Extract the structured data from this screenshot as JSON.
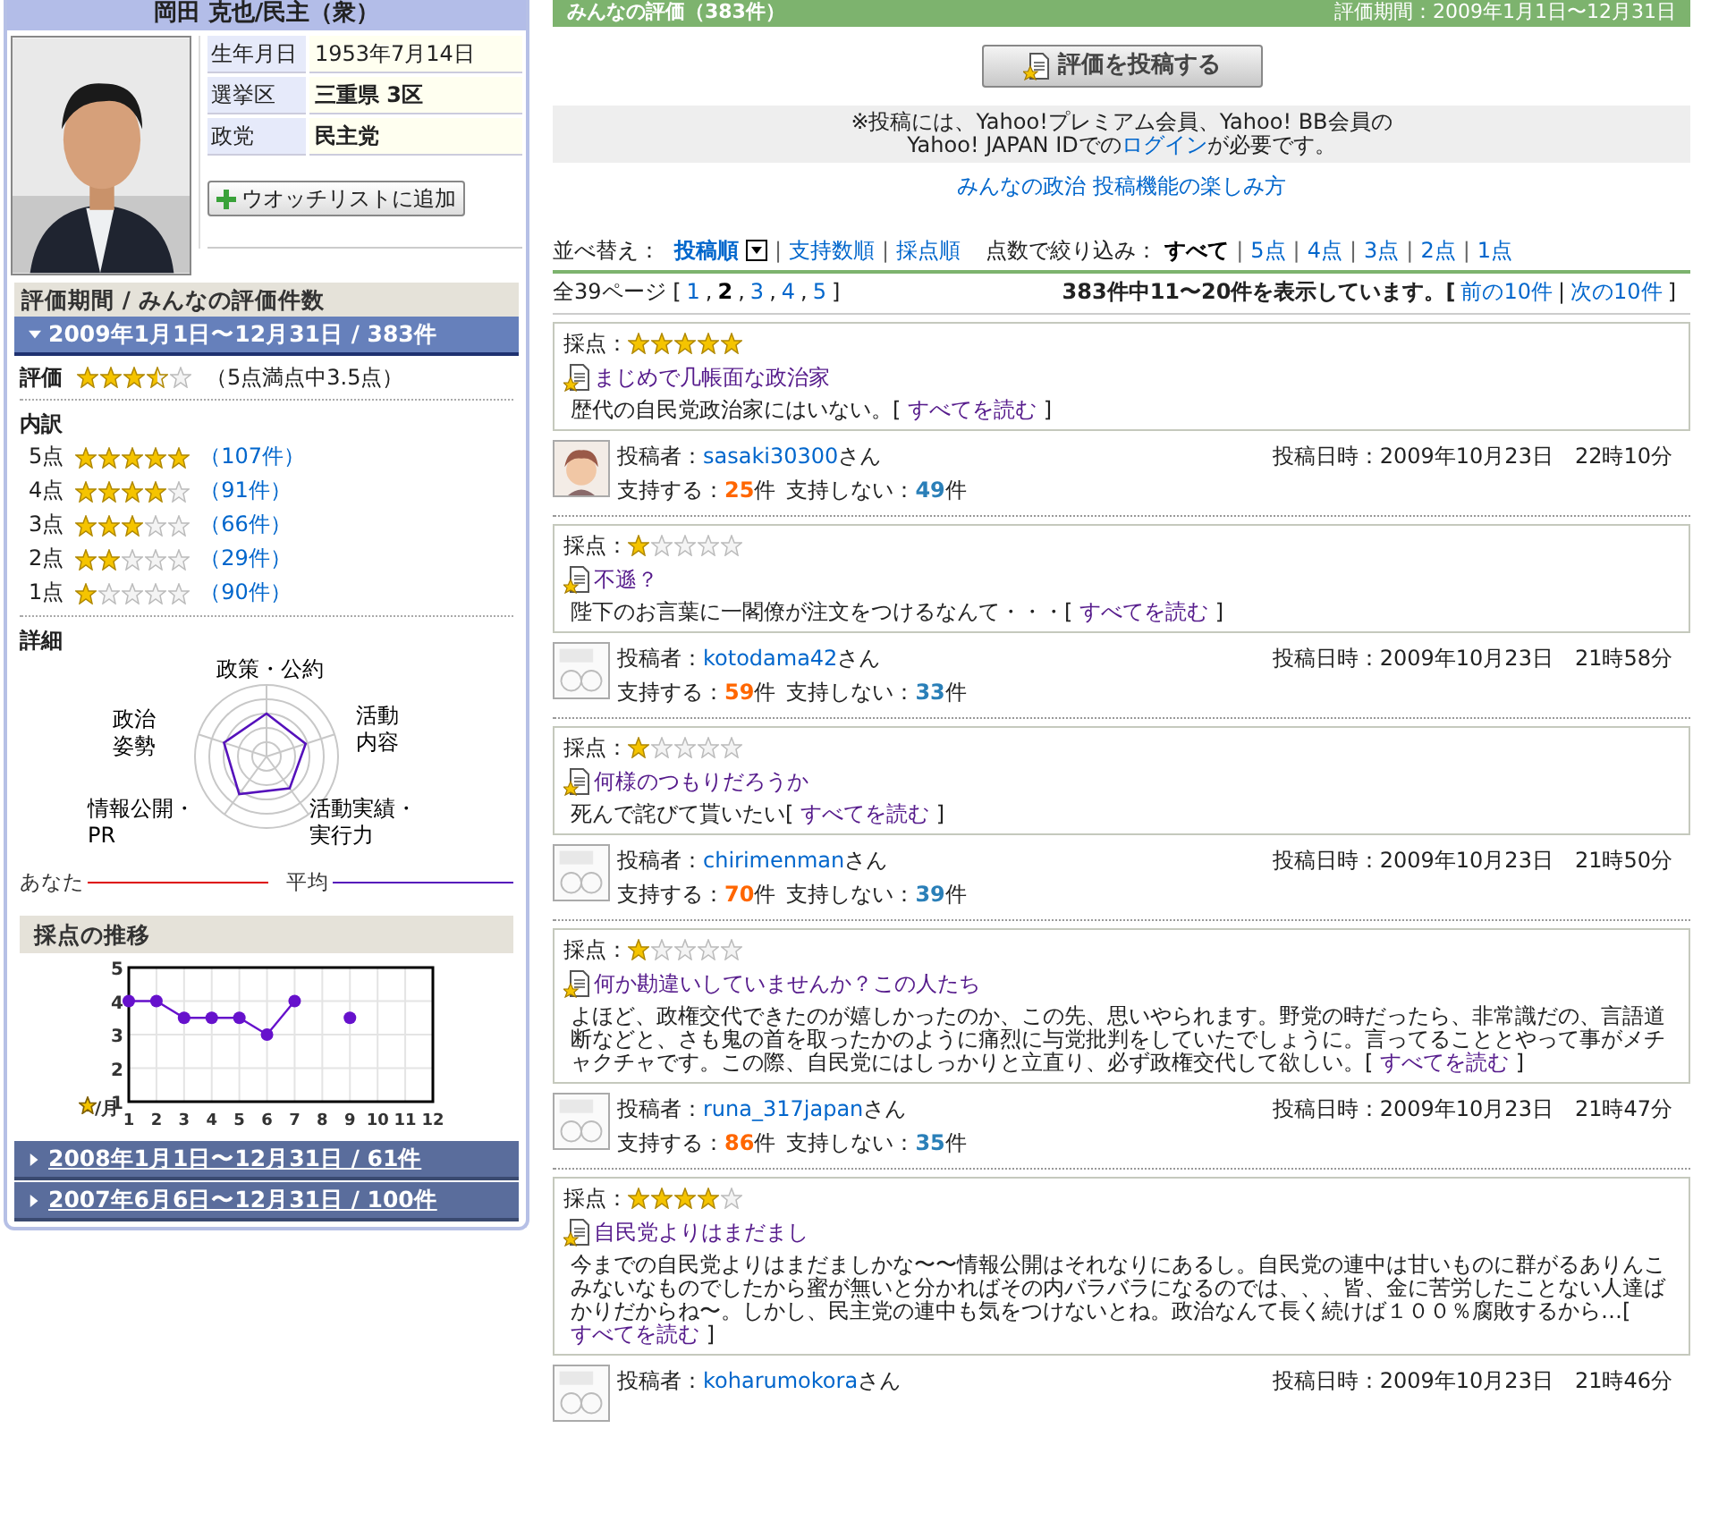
{
  "profile": {
    "name": "岡田 克也/民主（衆）",
    "info": [
      {
        "label": "生年月日",
        "value": "1953年7月14日",
        "bold": false
      },
      {
        "label": "選挙区",
        "value": "三重県 3区",
        "bold": true
      },
      {
        "label": "政党",
        "value": "民主党",
        "bold": true
      }
    ],
    "watch_button": "ウオッチリストに追加"
  },
  "periods_header": "評価期間 / みんなの評価件数",
  "periods": [
    {
      "label": "2009年1月1日〜12月31日 / 383件",
      "expanded": true
    },
    {
      "label": "2008年1月1日〜12月31日 / 61件",
      "expanded": false
    },
    {
      "label": "2007年6月6日〜12月31日 / 100件",
      "expanded": false
    }
  ],
  "current": {
    "rating": {
      "label": "評価",
      "stars": 3.5,
      "text": "（5点満点中3.5点）"
    },
    "breakdown": {
      "title": "内訳",
      "rows": [
        {
          "label": "5点",
          "stars": 5,
          "count": "（107件）"
        },
        {
          "label": "4点",
          "stars": 4,
          "count": "（91件）"
        },
        {
          "label": "3点",
          "stars": 3,
          "count": "（66件）"
        },
        {
          "label": "2点",
          "stars": 2,
          "count": "（29件）"
        },
        {
          "label": "1点",
          "stars": 1,
          "count": "（90件）"
        }
      ]
    },
    "detail": {
      "title": "詳細",
      "axes": [
        "政策・公約",
        "政治姿勢",
        "活動内容",
        "情報公開・PR",
        "活動実績・実行力"
      ],
      "legend": [
        {
          "label": "あなた",
          "color": "#dd0000"
        },
        {
          "label": "平均",
          "color": "#5511bb"
        }
      ]
    },
    "trend": {
      "title": "採点の推移",
      "corner_label": "/月",
      "chart_data": {
        "type": "line",
        "grid": true,
        "categories": [
          "1",
          "2",
          "3",
          "4",
          "5",
          "6",
          "7",
          "8",
          "9",
          "10",
          "11",
          "12"
        ],
        "yticks": [
          1,
          2,
          3,
          4,
          5
        ],
        "ylim": [
          1,
          5
        ],
        "series": [
          {
            "marker": true,
            "color": "#6611cc",
            "values": [
              4,
              4,
              3.5,
              3.5,
              3.5,
              3,
              4,
              null,
              3.5,
              null,
              null,
              null
            ]
          }
        ]
      }
    }
  },
  "reviews_header": {
    "title": "みんなの評価（383件）",
    "period": "評価期間：2009年1月1日〜12月31日"
  },
  "post_button": "評価を投稿する",
  "notice": {
    "line1": "※投稿には、Yahoo!プレミアム会員、Yahoo! BB会員の",
    "line2_before": "Yahoo! JAPAN IDでの",
    "login_link": "ログイン",
    "line2_after": "が必要です。"
  },
  "help_link": "みんなの政治 投稿機能の楽しみ方",
  "sort": {
    "label": "並べ替え：",
    "options": [
      {
        "label": "投稿順",
        "selected": true
      },
      {
        "sep": "|",
        "label": "支持数順",
        "selected": false
      },
      {
        "sep": "|",
        "label": "採点順",
        "selected": false
      }
    ]
  },
  "filter": {
    "label": "点数で絞り込み：",
    "options": [
      {
        "label": "すべて",
        "selected": true
      },
      {
        "sep": "|",
        "label": "5点",
        "selected": false
      },
      {
        "sep": "|",
        "label": "4点",
        "selected": false
      },
      {
        "sep": "|",
        "label": "3点",
        "selected": false
      },
      {
        "sep": "|",
        "label": "2点",
        "selected": false
      },
      {
        "sep": "|",
        "label": "1点",
        "selected": false
      }
    ]
  },
  "pagination": {
    "prefix": "全39ページ [",
    "pages": [
      {
        "label": "1",
        "selected": false
      },
      {
        "sep": ",",
        "label": "2",
        "selected": true
      },
      {
        "sep": ",",
        "label": "3",
        "selected": false
      },
      {
        "sep": ",",
        "label": "4",
        "selected": false
      },
      {
        "sep": ",",
        "label": "5",
        "selected": false
      }
    ],
    "suffix": "]",
    "summary": "383件中11〜20件を表示しています。[",
    "prev": "前の10件",
    "divider": "|",
    "next": "次の10件",
    "end": "]"
  },
  "reviews": [
    {
      "score_label": "採点：",
      "stars": 5,
      "title": "まじめで几帳面な政治家",
      "body": "歴代の自民党政治家にはいない。[ ",
      "read_more": "すべてを読む",
      "close": " ]",
      "avatar": {
        "kind": "custom"
      },
      "author_label": "投稿者：",
      "author": "sasaki30300",
      "author_suffix": "さん",
      "date_label": "投稿日時：",
      "date": "2009年10月23日　22時10分",
      "support_label": "支持する：",
      "support": "25",
      "support_unit": "件",
      "oppose_label": "支持しない：",
      "oppose": "49",
      "oppose_unit": "件"
    },
    {
      "score_label": "採点：",
      "stars": 1,
      "title": "不遜？",
      "body": "陛下のお言葉に一閣僚が注文をつけるなんて・・・[ ",
      "read_more": "すべてを読む",
      "close": " ]",
      "avatar": {
        "kind": "unset"
      },
      "author_label": "投稿者：",
      "author": "kotodama42",
      "author_suffix": "さん",
      "date_label": "投稿日時：",
      "date": "2009年10月23日　21時58分",
      "support_label": "支持する：",
      "support": "59",
      "support_unit": "件",
      "oppose_label": "支持しない：",
      "oppose": "33",
      "oppose_unit": "件"
    },
    {
      "score_label": "採点：",
      "stars": 1,
      "title": "何様のつもりだろうか",
      "body": "死んで詫びて貰いたい[ ",
      "read_more": "すべてを読む",
      "close": " ]",
      "avatar": {
        "kind": "unset"
      },
      "author_label": "投稿者：",
      "author": "chirimenman",
      "author_suffix": "さん",
      "date_label": "投稿日時：",
      "date": "2009年10月23日　21時50分",
      "support_label": "支持する：",
      "support": "70",
      "support_unit": "件",
      "oppose_label": "支持しない：",
      "oppose": "39",
      "oppose_unit": "件"
    },
    {
      "score_label": "採点：",
      "stars": 1,
      "title": "何か勘違いしていませんか？この人たち",
      "body": "よほど、政権交代できたのが嬉しかったのか、この先、思いやられます。野党の時だったら、非常識だの、言語道断などと、さも鬼の首を取ったかのように痛烈に与党批判をしていたでしょうに。言ってることとやって事がメチャクチャです。この際、自民党にはしっかりと立直り、必ず政権交代して欲しい。[ ",
      "read_more": "すべてを読む",
      "close": " ]",
      "avatar": {
        "kind": "unset"
      },
      "author_label": "投稿者：",
      "author": "runa_317japan",
      "author_suffix": "さん",
      "date_label": "投稿日時：",
      "date": "2009年10月23日　21時47分",
      "support_label": "支持する：",
      "support": "86",
      "support_unit": "件",
      "oppose_label": "支持しない：",
      "oppose": "35",
      "oppose_unit": "件"
    },
    {
      "score_label": "採点：",
      "stars": 4,
      "title": "自民党よりはまだまし",
      "body": "今までの自民党よりはまだましかな〜〜情報公開はそれなりにあるし。自民党の連中は甘いものに群がるありんこみないなものでしたから蜜が無いと分かればその内バラバラになるのでは、、、皆、金に苦労したことない人達ばかりだからね〜。しかし、民主党の連中も気をつけないとね。政治なんて長く続けば１００％腐敗するから…[ ",
      "read_more": "すべてを読む",
      "close": " ]",
      "avatar": {
        "kind": "unset"
      },
      "author_label": "投稿者：",
      "author": "koharumokora",
      "author_suffix": "さん",
      "date_label": "投稿日時：",
      "date": "2009年10月23日　21時46分"
    }
  ]
}
